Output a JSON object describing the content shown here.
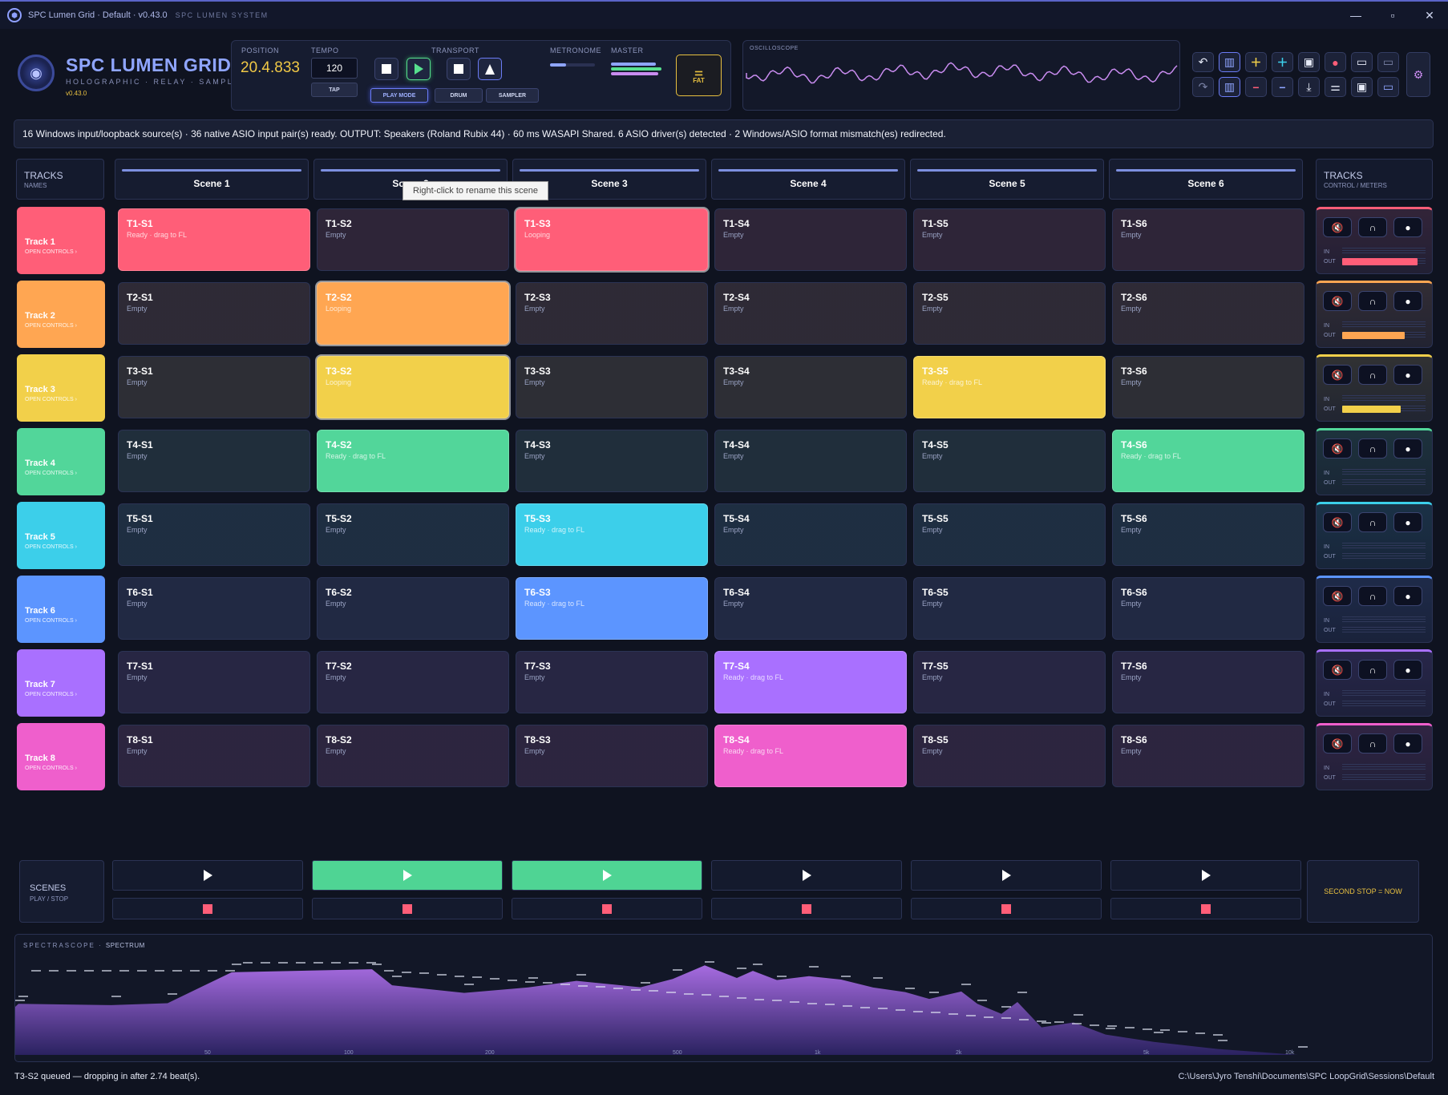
{
  "window": {
    "title": "SPC Lumen Grid · Default · v0.43.0",
    "subtitle": "SPC LUMEN SYSTEM",
    "min": "—",
    "max": "▫",
    "close": "✕"
  },
  "logo": {
    "title": "SPC LUMEN GRID",
    "subtitle": "HOLOGRAPHIC · RELAY · SAMPLER",
    "version": "v0.43.0"
  },
  "transport": {
    "position_label": "POSITION",
    "position": "20.4.833",
    "tempo_label": "TEMPO",
    "tempo": "120",
    "tap": "TAP",
    "transport_label": "TRANSPORT",
    "play_mode": "PLAY MODE",
    "drum": "DRUM",
    "sampler": "SAMPLER",
    "metronome_label": "METRONOME",
    "master_label": "MASTER",
    "metronome_level": 0.35,
    "master_levels": [
      0.85,
      0.95,
      0.9
    ],
    "fat": "FAT"
  },
  "oscilloscope": {
    "label": "OSCILLOSCOPE"
  },
  "colors": {
    "accent": "#8fa5ff",
    "play": "#57e08e",
    "stop": "#ff5e78",
    "gold": "#e8c040"
  },
  "status_banner": "16 Windows input/loopback source(s) · 36 native ASIO input pair(s) ready. OUTPUT: Speakers (Roland Rubix 44) · 60 ms WASAPI Shared. 6 ASIO driver(s) detected · 2 Windows/ASIO format mismatch(es) redirected.",
  "tracks_header": {
    "title": "TRACKS",
    "sub": "NAMES"
  },
  "control_header": {
    "title": "TRACKS",
    "sub": "CONTROL / METERS"
  },
  "scenes": [
    "Scene 1",
    "Scene 2",
    "Scene 3",
    "Scene 4",
    "Scene 5",
    "Scene 6"
  ],
  "tooltip": "Right-click to rename this scene",
  "tracks": [
    {
      "name": "Track 1",
      "open": "OPEN CONTROLS ›",
      "color": "#ff5e78",
      "out": 0.9,
      "clips": [
        {
          "n": "T1-S1",
          "s": "Ready · drag to FL"
        },
        {
          "n": "T1-S2",
          "s": "Empty"
        },
        {
          "n": "T1-S3",
          "s": "Looping"
        },
        {
          "n": "T1-S4",
          "s": "Empty"
        },
        {
          "n": "T1-S5",
          "s": "Empty"
        },
        {
          "n": "T1-S6",
          "s": "Empty"
        }
      ]
    },
    {
      "name": "Track 2",
      "open": "OPEN CONTROLS ›",
      "color": "#ffa652",
      "out": 0.75,
      "clips": [
        {
          "n": "T2-S1",
          "s": "Empty"
        },
        {
          "n": "T2-S2",
          "s": "Looping"
        },
        {
          "n": "T2-S3",
          "s": "Empty"
        },
        {
          "n": "T2-S4",
          "s": "Empty"
        },
        {
          "n": "T2-S5",
          "s": "Empty"
        },
        {
          "n": "T2-S6",
          "s": "Empty"
        }
      ]
    },
    {
      "name": "Track 3",
      "open": "OPEN CONTROLS ›",
      "color": "#f2d04a",
      "out": 0.7,
      "clips": [
        {
          "n": "T3-S1",
          "s": "Empty"
        },
        {
          "n": "T3-S2",
          "s": "Looping"
        },
        {
          "n": "T3-S3",
          "s": "Empty"
        },
        {
          "n": "T3-S4",
          "s": "Empty"
        },
        {
          "n": "T3-S5",
          "s": "Ready · drag to FL"
        },
        {
          "n": "T3-S6",
          "s": "Empty"
        }
      ]
    },
    {
      "name": "Track 4",
      "open": "OPEN CONTROLS ›",
      "color": "#52d69a",
      "out": 0,
      "clips": [
        {
          "n": "T4-S1",
          "s": "Empty"
        },
        {
          "n": "T4-S2",
          "s": "Ready · drag to FL"
        },
        {
          "n": "T4-S3",
          "s": "Empty"
        },
        {
          "n": "T4-S4",
          "s": "Empty"
        },
        {
          "n": "T4-S5",
          "s": "Empty"
        },
        {
          "n": "T4-S6",
          "s": "Ready · drag to FL"
        }
      ]
    },
    {
      "name": "Track 5",
      "open": "OPEN CONTROLS ›",
      "color": "#3ccfea",
      "out": 0,
      "clips": [
        {
          "n": "T5-S1",
          "s": "Empty"
        },
        {
          "n": "T5-S2",
          "s": "Empty"
        },
        {
          "n": "T5-S3",
          "s": "Ready · drag to FL"
        },
        {
          "n": "T5-S4",
          "s": "Empty"
        },
        {
          "n": "T5-S5",
          "s": "Empty"
        },
        {
          "n": "T5-S6",
          "s": "Empty"
        }
      ]
    },
    {
      "name": "Track 6",
      "open": "OPEN CONTROLS ›",
      "color": "#5c95ff",
      "out": 0,
      "clips": [
        {
          "n": "T6-S1",
          "s": "Empty"
        },
        {
          "n": "T6-S2",
          "s": "Empty"
        },
        {
          "n": "T6-S3",
          "s": "Ready · drag to FL"
        },
        {
          "n": "T6-S4",
          "s": "Empty"
        },
        {
          "n": "T6-S5",
          "s": "Empty"
        },
        {
          "n": "T6-S6",
          "s": "Empty"
        }
      ]
    },
    {
      "name": "Track 7",
      "open": "OPEN CONTROLS ›",
      "color": "#a970ff",
      "out": 0,
      "clips": [
        {
          "n": "T7-S1",
          "s": "Empty"
        },
        {
          "n": "T7-S2",
          "s": "Empty"
        },
        {
          "n": "T7-S3",
          "s": "Empty"
        },
        {
          "n": "T7-S4",
          "s": "Ready · drag to FL"
        },
        {
          "n": "T7-S5",
          "s": "Empty"
        },
        {
          "n": "T7-S6",
          "s": "Empty"
        }
      ]
    },
    {
      "name": "Track 8",
      "open": "OPEN CONTROLS ›",
      "color": "#ef5fcc",
      "out": 0,
      "clips": [
        {
          "n": "T8-S1",
          "s": "Empty"
        },
        {
          "n": "T8-S2",
          "s": "Empty"
        },
        {
          "n": "T8-S3",
          "s": "Empty"
        },
        {
          "n": "T8-S4",
          "s": "Ready · drag to FL"
        },
        {
          "n": "T8-S5",
          "s": "Empty"
        },
        {
          "n": "T8-S6",
          "s": "Empty"
        }
      ]
    }
  ],
  "control_labels": {
    "in": "IN",
    "out": "OUT",
    "mute": "🔇",
    "solo": "∩",
    "rec": "●"
  },
  "scenes_panel": {
    "title": "SCENES",
    "sub": "PLAY / STOP",
    "active": [
      false,
      true,
      true,
      false,
      false,
      false
    ]
  },
  "second_stop": "SECOND STOP = NOW",
  "spectrum": {
    "title": "SPECTRASCOPE",
    "sub": "SPECTRUM",
    "freq_labels": [
      "50",
      "100",
      "200",
      "500",
      "1k",
      "2k",
      "5k",
      "10k"
    ]
  },
  "footer": {
    "left": "T3-S2 queued — dropping in after 2.74 beat(s).",
    "right": "C:\\Users\\Jyro Tenshi\\Documents\\SPC LoopGrid\\Sessions\\Default"
  }
}
